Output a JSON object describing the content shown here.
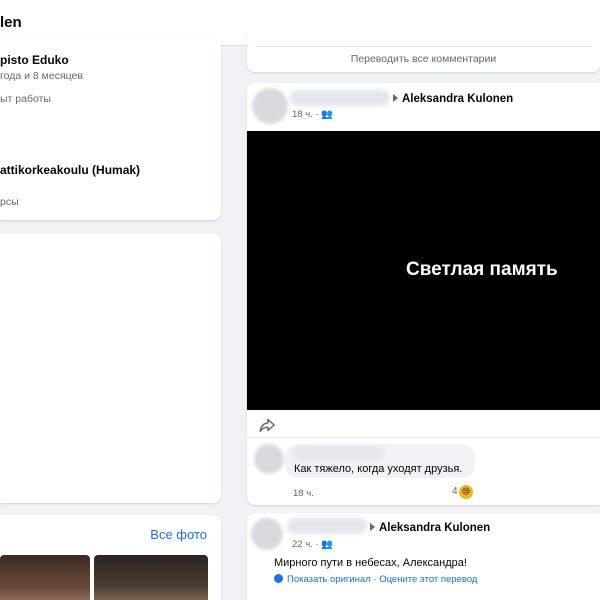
{
  "header": {
    "title_partial": "len"
  },
  "about": {
    "edu1_name": "pisto Eduko",
    "edu1_duration": "года и 8 месяцев",
    "edu1_extra": "ыт работы",
    "edu2_name": "attikorkeakoulu (Humak)",
    "edu2_extra": "рсы"
  },
  "photos": {
    "see_all_label": "Все фото"
  },
  "comments_bar": {
    "translate_all_label": "Переводить все комментарии"
  },
  "post1": {
    "author": "Aleksandra Kulonen",
    "time": "18 ч.",
    "video_text": "Светлая память",
    "comment": {
      "text": "Как тяжело, когда уходят друзья.",
      "time": "18 ч.",
      "reaction_count": "4",
      "reaction_emoji": "😢"
    }
  },
  "post2": {
    "author": "Aleksandra Kulonen",
    "time": "22 ч.",
    "text": "Мирного пути в небесах, Александра!",
    "show_original_label": "Показать оригинал",
    "separator": " · ",
    "rate_translation_label": "Оцените этот перевод"
  },
  "colors": {
    "link": "#216fdb",
    "secondary_text": "#65676b",
    "page_bg": "#f0f2f5"
  },
  "icons": {
    "share": "share-arrow-icon",
    "audience": "friends-icon",
    "translate": "globe-icon"
  }
}
